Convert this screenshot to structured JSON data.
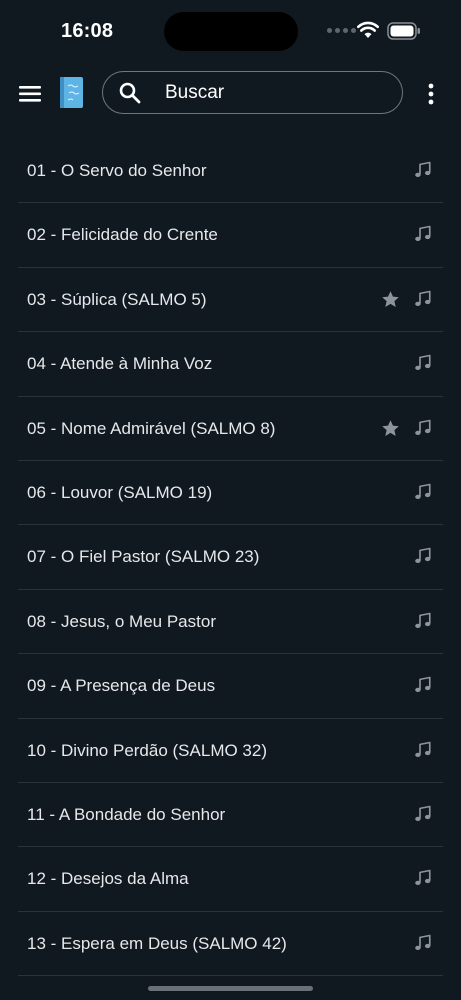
{
  "status_bar": {
    "time": "16:08"
  },
  "search": {
    "placeholder": "Buscar"
  },
  "songs": [
    {
      "label": "01 - O Servo do Senhor",
      "favorite": false
    },
    {
      "label": "02 - Felicidade do Crente",
      "favorite": false
    },
    {
      "label": "03 - Súplica (SALMO 5)",
      "favorite": true
    },
    {
      "label": "04 - Atende à Minha Voz",
      "favorite": false
    },
    {
      "label": "05 - Nome Admirável (SALMO 8)",
      "favorite": true
    },
    {
      "label": "06 - Louvor (SALMO 19)",
      "favorite": false
    },
    {
      "label": "07 - O Fiel Pastor (SALMO 23)",
      "favorite": false
    },
    {
      "label": "08 - Jesus, o Meu Pastor",
      "favorite": false
    },
    {
      "label": "09 - A Presença de Deus",
      "favorite": false
    },
    {
      "label": "10 - Divino Perdão (SALMO 32)",
      "favorite": false
    },
    {
      "label": "11 - A Bondade do Senhor",
      "favorite": false
    },
    {
      "label": "12 - Desejos da Alma",
      "favorite": false
    },
    {
      "label": "13 - Espera em Deus (SALMO 42)",
      "favorite": false
    }
  ],
  "icons": {
    "menu": "menu-icon",
    "logo": "book-logo",
    "search": "search-icon",
    "more": "more-vertical-icon",
    "favorite": "star-icon",
    "audio": "music-note-icon"
  },
  "colors": {
    "background": "#101820",
    "text": "#e6e8ea",
    "icon": "#8d949b",
    "divider": "#2a333c",
    "logo": "#5fb4e6"
  }
}
